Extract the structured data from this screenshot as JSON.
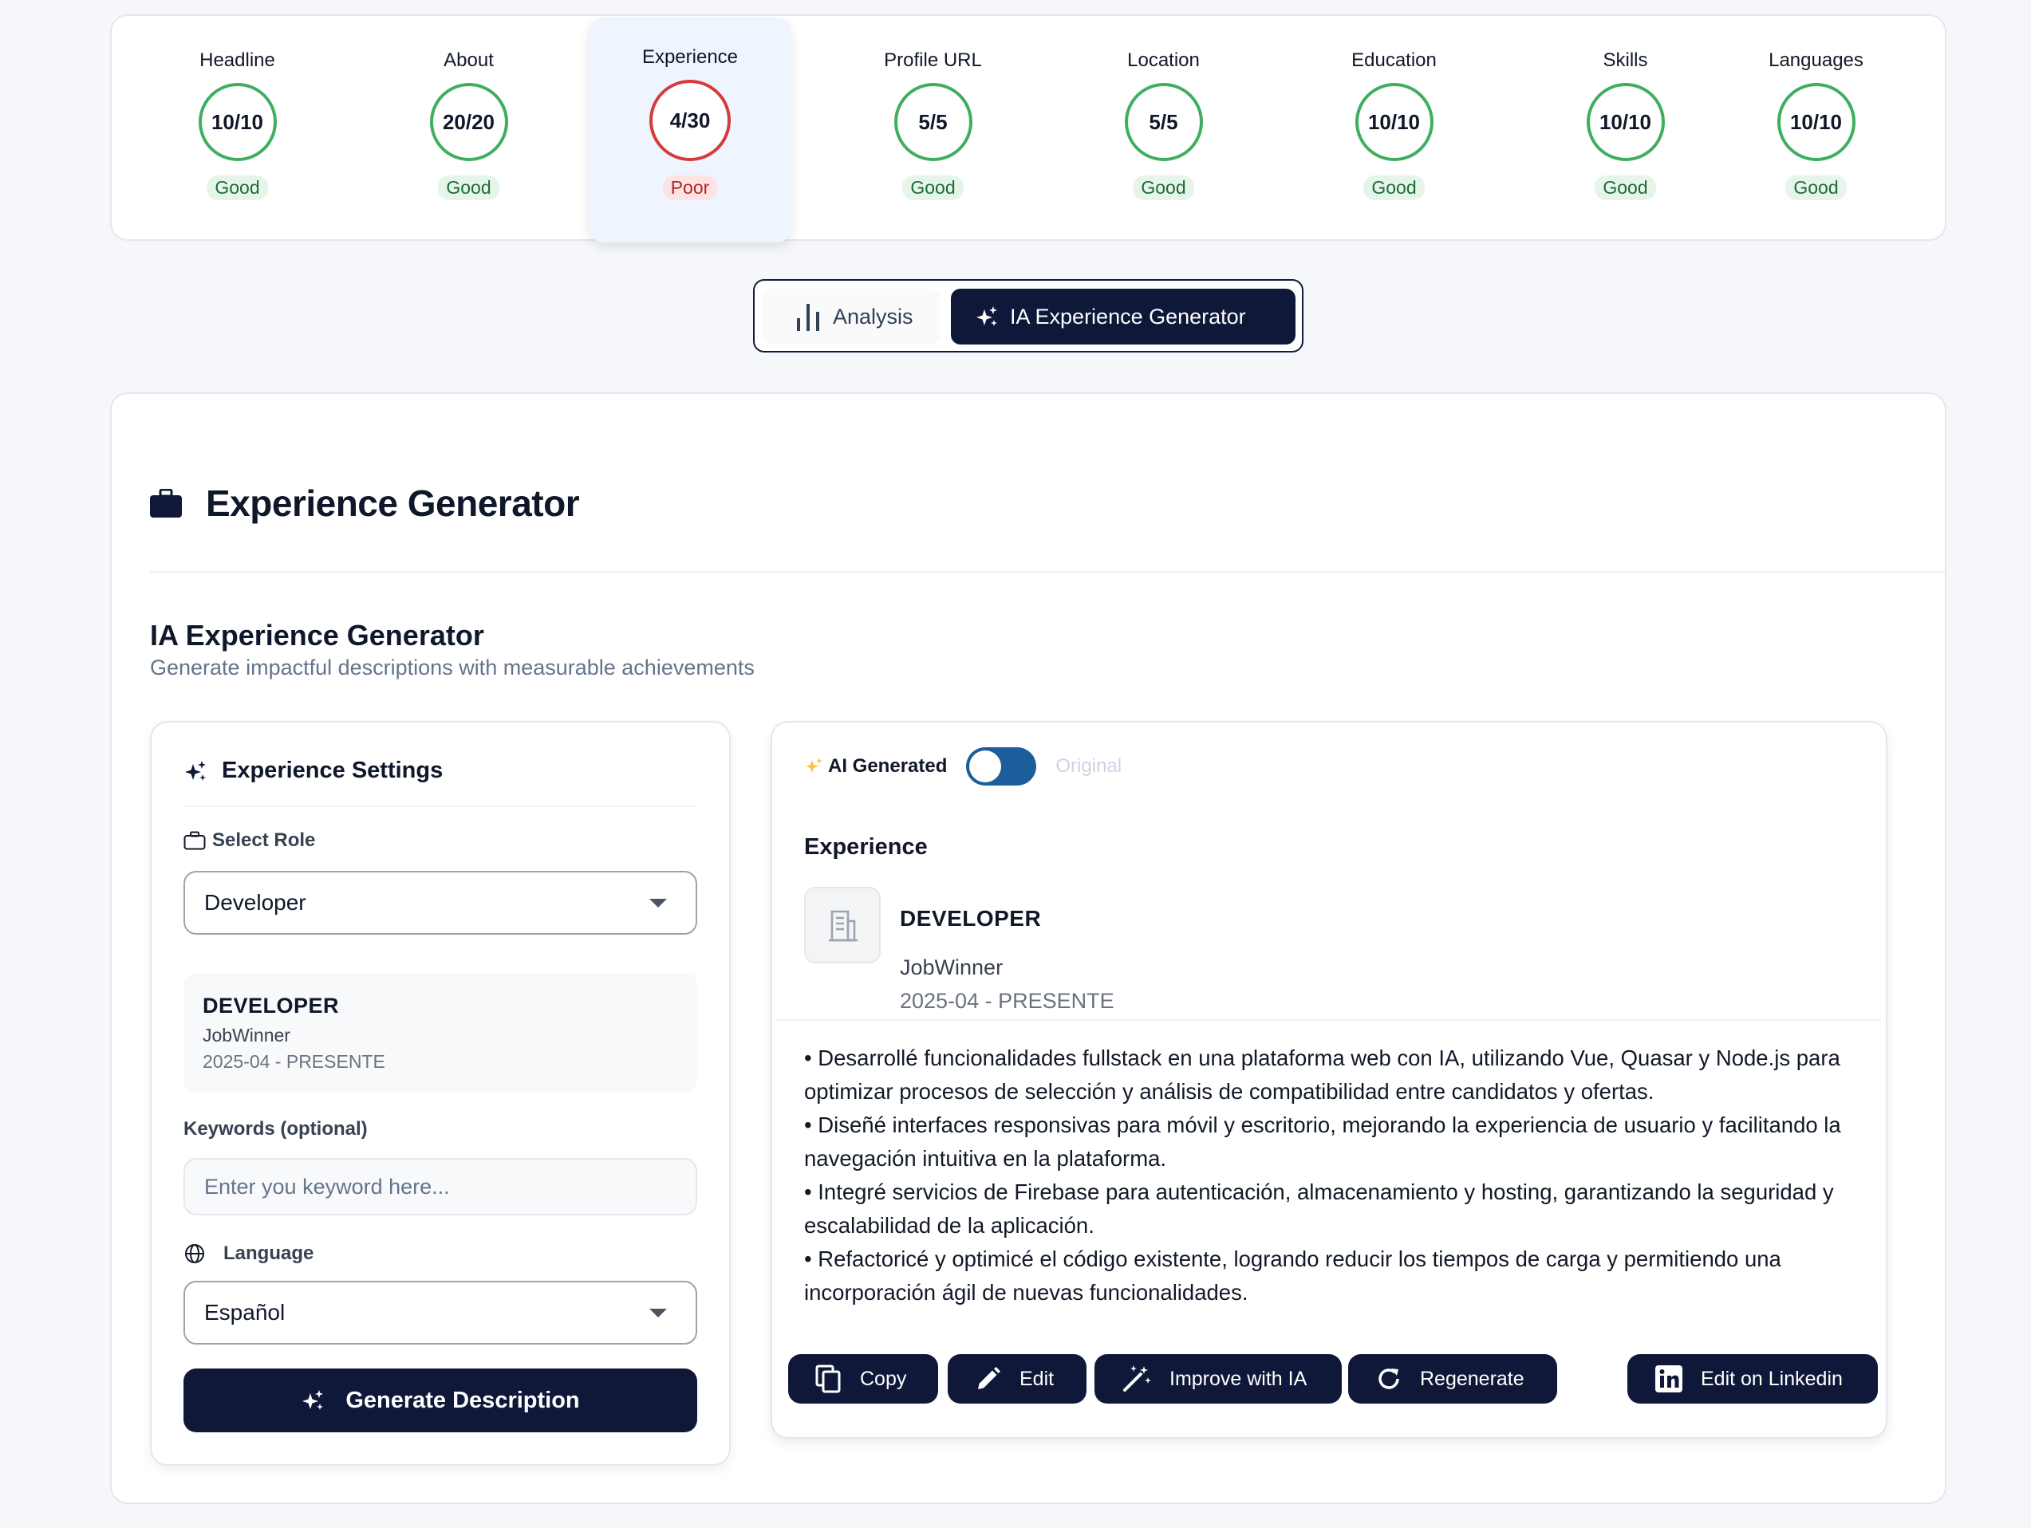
{
  "scores": [
    {
      "label": "Headline",
      "value": "10/10",
      "status": "Good"
    },
    {
      "label": "About",
      "value": "20/20",
      "status": "Good"
    },
    {
      "label": "Experience",
      "value": "4/30",
      "status": "Poor"
    },
    {
      "label": "Profile URL",
      "value": "5/5",
      "status": "Good"
    },
    {
      "label": "Location",
      "value": "5/5",
      "status": "Good"
    },
    {
      "label": "Education",
      "value": "10/10",
      "status": "Good"
    },
    {
      "label": "Skills",
      "value": "10/10",
      "status": "Good"
    },
    {
      "label": "Languages",
      "value": "10/10",
      "status": "Good"
    }
  ],
  "colors": {
    "good": "#3fae5f",
    "poor": "#d63b3b",
    "navy": "#0f1838",
    "toggle": "#1c5e9c"
  },
  "tabs": {
    "analysis": "Analysis",
    "generator": "IA Experience Generator"
  },
  "main": {
    "title": "Experience Generator",
    "section_title": "IA Experience Generator",
    "section_subtitle": "Generate impactful descriptions with measurable achievements"
  },
  "settings": {
    "title": "Experience Settings",
    "role_label": "Select Role",
    "role_value": "Developer",
    "role_card": {
      "title": "DEVELOPER",
      "company": "JobWinner",
      "dates": "2025-04 - PRESENTE"
    },
    "keywords_label": "Keywords (optional)",
    "keywords_placeholder": "Enter you keyword here...",
    "language_label": "Language",
    "language_value": "Español",
    "generate_label": "Generate Description"
  },
  "output": {
    "ai_label": "AI Generated",
    "original_label": "Original",
    "toggle_on": true,
    "heading": "Experience",
    "role": "DEVELOPER",
    "company": "JobWinner",
    "dates": "2025-04 - PRESENTE",
    "bullets": [
      "• Desarrollé funcionalidades fullstack en una plataforma web con IA, utilizando Vue, Quasar y Node.js para optimizar procesos de selección y análisis de compatibilidad entre candidatos y ofertas.",
      "• Diseñé interfaces responsivas para móvil y escritorio, mejorando la experiencia de usuario y facilitando la navegación intuitiva en la plataforma.",
      "• Integré servicios de Firebase para autenticación, almacenamiento y hosting, garantizando la seguridad y escalabilidad de la aplicación.",
      "• Refactoricé y optimicé el código existente, logrando reducir los tiempos de carga y permitiendo una incorporación ágil de nuevas funcionalidades."
    ],
    "actions": {
      "copy": "Copy",
      "edit": "Edit",
      "improve": "Improve with IA",
      "regenerate": "Regenerate",
      "linkedin": "Edit on Linkedin"
    }
  }
}
